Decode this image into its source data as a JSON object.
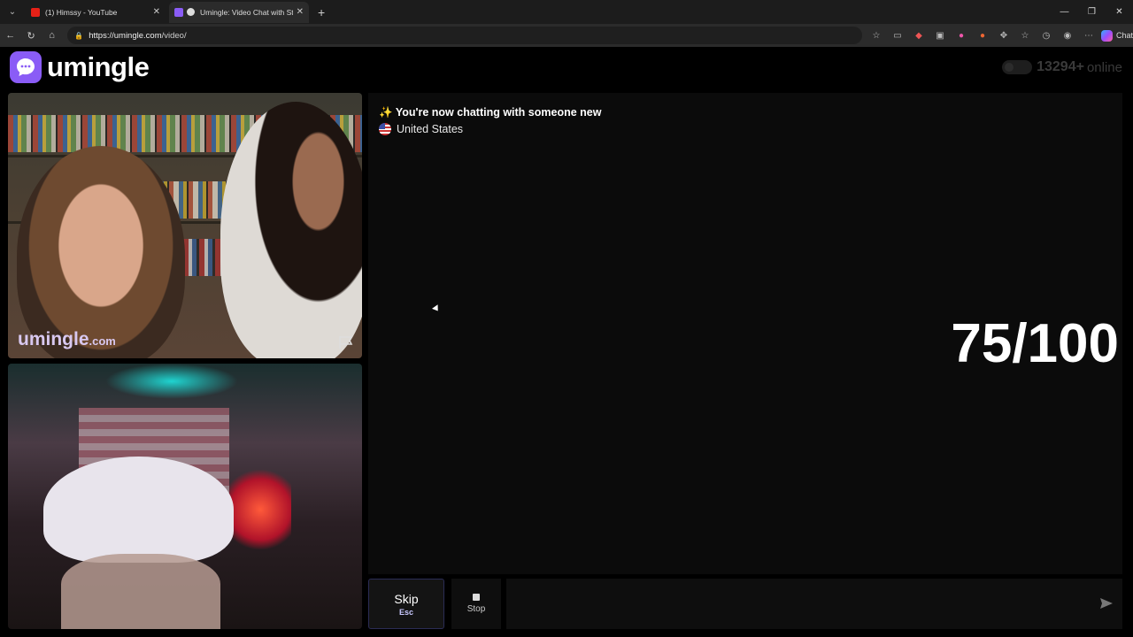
{
  "browser": {
    "tabs": [
      {
        "title": "(1) Himssy - YouTube",
        "favicon_color": "#e62117"
      },
      {
        "title": "Umingle: Video Chat with Stra",
        "favicon_color": "#8a5cf6"
      }
    ],
    "new_tab_icon": "plus-icon",
    "url_host": "https://umingle.com",
    "url_path": "/video/",
    "copilot_label": "Chat"
  },
  "site": {
    "logo_text": "umingle",
    "online_count": "13294+",
    "online_label": "online"
  },
  "videos": {
    "watermark": "umingle",
    "watermark_suffix": ".com"
  },
  "chat": {
    "system_icon": "✨",
    "system_message": "You're now chatting with someone new",
    "country": "United States",
    "overlay_score": "75/100"
  },
  "controls": {
    "skip_label": "Skip",
    "skip_key": "Esc",
    "stop_label": "Stop",
    "message_placeholder": ""
  },
  "colors": {
    "brand": "#8a5cf6",
    "skip_border": "#2b2c55"
  }
}
